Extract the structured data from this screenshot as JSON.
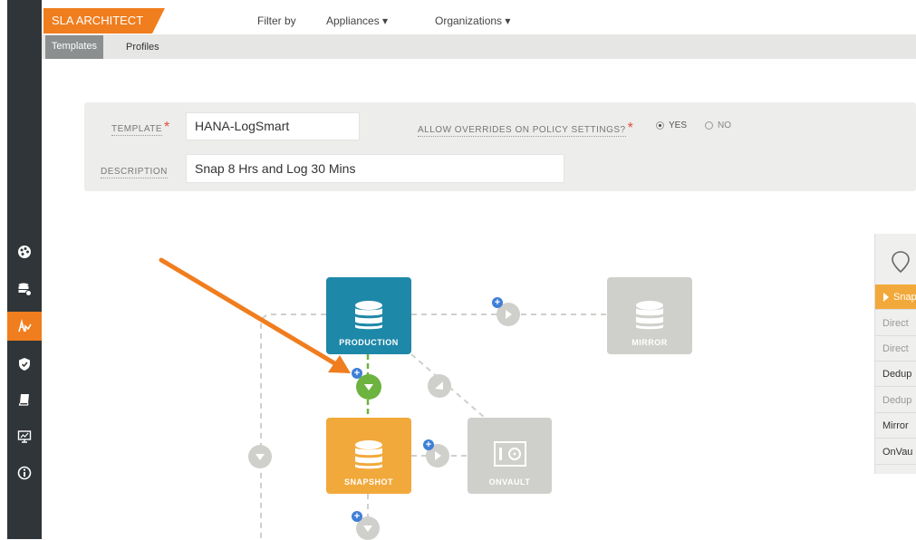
{
  "app": {
    "name": "SLA ARCHITECT"
  },
  "topnav": {
    "filter_label": "Filter by",
    "appliances": "Appliances ▾",
    "organizations": "Organizations ▾"
  },
  "tabs": {
    "templates": "Templates",
    "profiles": "Profiles"
  },
  "form": {
    "template_label": "TEMPLATE",
    "template_value": "HANA-LogSmart",
    "required_mark": "*",
    "overrides_label": "ALLOW OVERRIDES ON POLICY SETTINGS?",
    "yes_label": "YES",
    "no_label": "NO",
    "overrides_selected": "YES",
    "description_label": "DESCRIPTION",
    "description_value": "Snap 8 Hrs and Log 30 Mins"
  },
  "workflow": {
    "production": "PRODUCTION",
    "mirror": "MIRROR",
    "snapshot": "SNAPSHOT",
    "onvault": "ONVAULT"
  },
  "right_panel": {
    "items": [
      "Snap",
      "Direct",
      "Direct",
      "Dedup",
      "Dedup",
      "Mirror",
      "OnVau"
    ]
  },
  "colors": {
    "accent": "#f07d1e",
    "production": "#1e88a8",
    "snapshot": "#f2a93b",
    "inactive": "#cfcfcb",
    "connector_active": "#6db33f"
  }
}
